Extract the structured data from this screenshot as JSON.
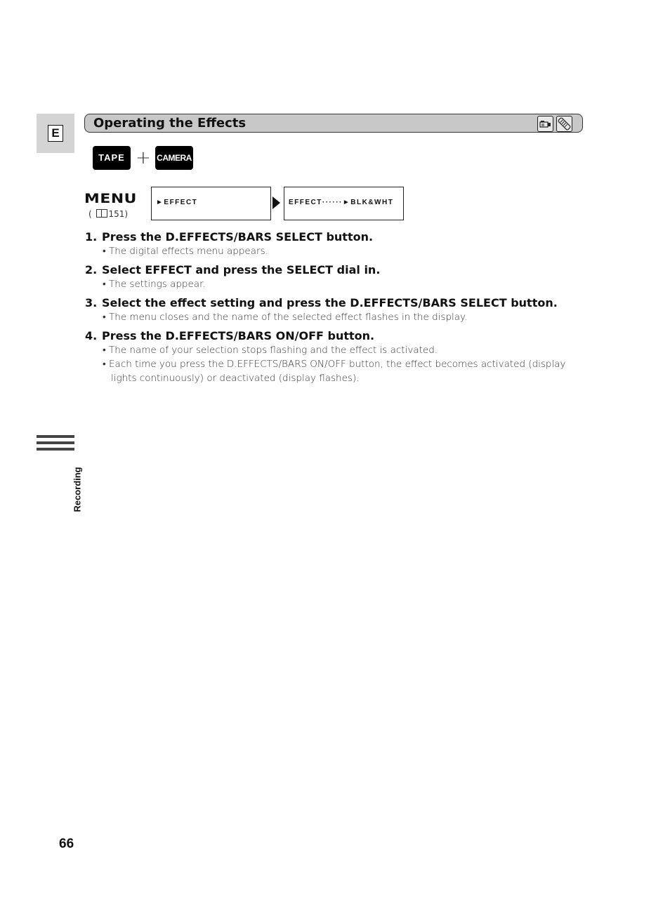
{
  "language_tab": "E",
  "section": {
    "title": "Operating the Effects",
    "icons": [
      "camcorder-icon",
      "remote-control-icon"
    ]
  },
  "mode": {
    "tape_label": "TAPE",
    "plus": "+",
    "camera_label": "CAMERA"
  },
  "menu": {
    "label": "MENU",
    "ref_open": "(",
    "ref_page": "151)",
    "screen1": "►EFFECT",
    "screen2": "EFFECT······►BLK&WHT"
  },
  "steps": [
    {
      "num": "1.",
      "text": "Press the D.EFFECTS/BARS SELECT button.",
      "bullets": [
        "The digital effects menu appears."
      ]
    },
    {
      "num": "2.",
      "text": "Select EFFECT and press the SELECT dial in.",
      "bullets": [
        "The settings appear."
      ]
    },
    {
      "num": "3.",
      "text": "Select the effect setting and press the D.EFFECTS/BARS SELECT button.",
      "bullets": [
        "The menu closes and the name of the selected effect flashes in the display."
      ]
    },
    {
      "num": "4.",
      "text": "Press the D.EFFECTS/BARS ON/OFF button.",
      "bullets": [
        "The name of your selection stops flashing and the effect is activated.",
        "Each time you press the D.EFFECTS/BARS ON/OFF button, the effect becomes activated (display lights continuously) or deactivated (display flashes)."
      ]
    }
  ],
  "side_label": "Recording",
  "page_number": "66"
}
